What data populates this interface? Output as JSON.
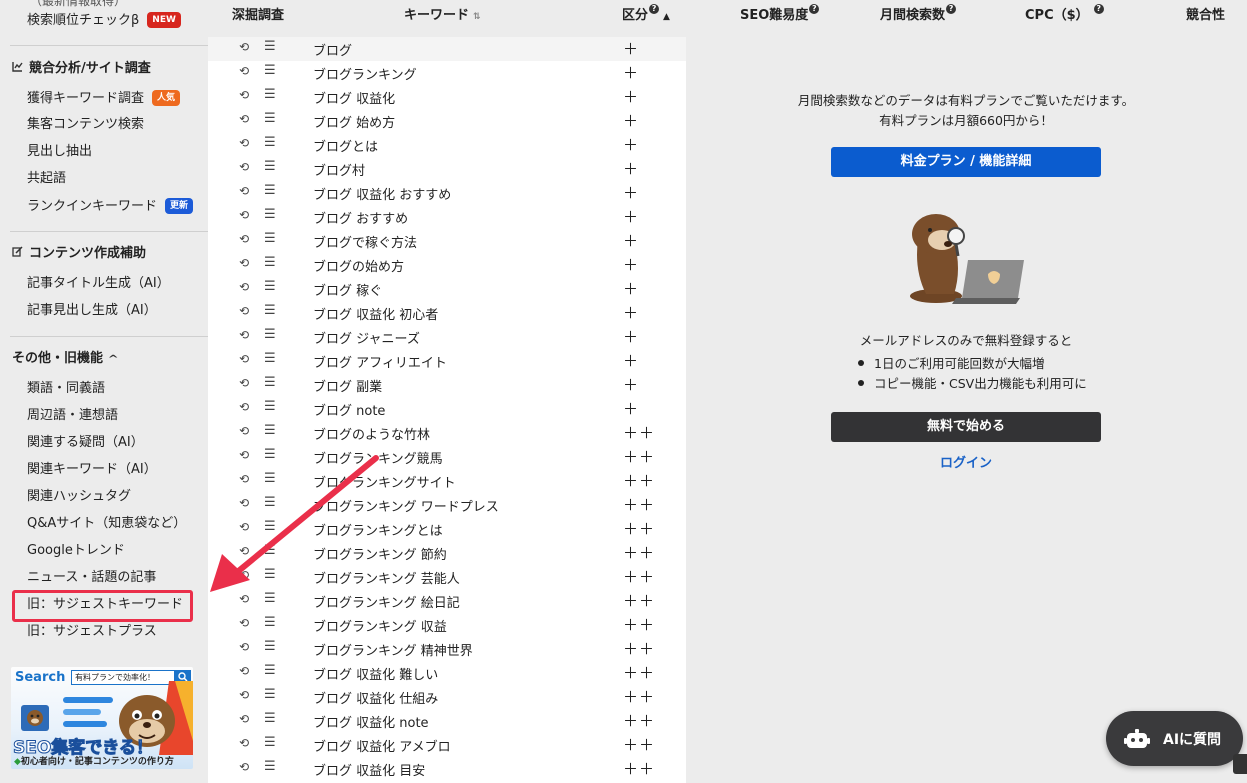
{
  "sidebar": {
    "top_cut": "（最新情報取得）",
    "items_top": [
      {
        "label": "検索順位チェックβ",
        "badge": "NEW"
      }
    ],
    "section_competitor": {
      "title": "競合分析/サイト調査",
      "items": [
        {
          "label": "獲得キーワード調査",
          "badge": "人気"
        },
        {
          "label": "集客コンテンツ検索",
          "badge": ""
        },
        {
          "label": "見出し抽出",
          "badge": ""
        },
        {
          "label": "共起語",
          "badge": ""
        },
        {
          "label": "ランクインキーワード",
          "badge": "更新"
        }
      ]
    },
    "section_content": {
      "title": "コンテンツ作成補助",
      "items": [
        {
          "label": "記事タイトル生成（AI）"
        },
        {
          "label": "記事見出し生成（AI）"
        }
      ]
    },
    "section_other": {
      "title": "その他・旧機能",
      "items": [
        {
          "label": "類語・同義語"
        },
        {
          "label": "周辺語・連想語"
        },
        {
          "label": "関連する疑問（AI）"
        },
        {
          "label": "関連キーワード（AI）"
        },
        {
          "label": "関連ハッシュタグ"
        },
        {
          "label": "Q&Aサイト（知恵袋など）"
        },
        {
          "label": "Googleトレンド"
        },
        {
          "label": "ニュース・話題の記事"
        },
        {
          "label": "旧：サジェストキーワード"
        },
        {
          "label": "旧：サジェストプラス"
        }
      ]
    },
    "banner": {
      "search_word": "Search",
      "box_text": "有料プランで効率化！",
      "title": "SEO集客できる！",
      "subtitle": "初心者向け・記事コンテンツの作り方"
    }
  },
  "header": {
    "col_dig": "深掘調査",
    "col_keyword": "キーワード",
    "col_category": "区分",
    "col_seo": "SEO難易度",
    "col_volume": "月間検索数",
    "col_cpc": "CPC（$）",
    "col_competition": "競合性"
  },
  "keywords": [
    {
      "kw": "ブログ",
      "cat": "＋"
    },
    {
      "kw": "ブログランキング",
      "cat": "＋"
    },
    {
      "kw": "ブログ 収益化",
      "cat": "＋"
    },
    {
      "kw": "ブログ 始め方",
      "cat": "＋"
    },
    {
      "kw": "ブログとは",
      "cat": "＋"
    },
    {
      "kw": "ブログ村",
      "cat": "＋"
    },
    {
      "kw": "ブログ 収益化 おすすめ",
      "cat": "＋"
    },
    {
      "kw": "ブログ おすすめ",
      "cat": "＋"
    },
    {
      "kw": "ブログで稼ぐ方法",
      "cat": "＋"
    },
    {
      "kw": "ブログの始め方",
      "cat": "＋"
    },
    {
      "kw": "ブログ 稼ぐ",
      "cat": "＋"
    },
    {
      "kw": "ブログ 収益化 初心者",
      "cat": "＋"
    },
    {
      "kw": "ブログ ジャニーズ",
      "cat": "＋"
    },
    {
      "kw": "ブログ アフィリエイト",
      "cat": "＋"
    },
    {
      "kw": "ブログ 副業",
      "cat": "＋"
    },
    {
      "kw": "ブログ note",
      "cat": "＋"
    },
    {
      "kw": "ブログのような竹林",
      "cat": "＋＋"
    },
    {
      "kw": "ブログランキング競馬",
      "cat": "＋＋"
    },
    {
      "kw": "ブログランキングサイト",
      "cat": "＋＋"
    },
    {
      "kw": "ブログランキング ワードプレス",
      "cat": "＋＋"
    },
    {
      "kw": "ブログランキングとは",
      "cat": "＋＋"
    },
    {
      "kw": "ブログランキング 節約",
      "cat": "＋＋"
    },
    {
      "kw": "ブログランキング 芸能人",
      "cat": "＋＋"
    },
    {
      "kw": "ブログランキング 絵日記",
      "cat": "＋＋"
    },
    {
      "kw": "ブログランキング 収益",
      "cat": "＋＋"
    },
    {
      "kw": "ブログランキング 精神世界",
      "cat": "＋＋"
    },
    {
      "kw": "ブログ 収益化 難しい",
      "cat": "＋＋"
    },
    {
      "kw": "ブログ 収益化 仕組み",
      "cat": "＋＋"
    },
    {
      "kw": "ブログ 収益化 note",
      "cat": "＋＋"
    },
    {
      "kw": "ブログ 収益化 アメブロ",
      "cat": "＋＋"
    },
    {
      "kw": "ブログ 収益化 目安",
      "cat": "＋＋"
    }
  ],
  "panel": {
    "msg_line1": "月間検索数などのデータは有料プランでご覧いただけます。",
    "msg_line2": "有料プランは月額660円から！",
    "plan_button": "料金プラン / 機能詳細",
    "register_msg": "メールアドレスのみで無料登録すると",
    "benefits": [
      "1日のご利用可能回数が大幅増",
      "コピー機能・CSV出力機能も利用可に"
    ],
    "start_button": "無料で始める",
    "login_link": "ログイン"
  },
  "ai_button": {
    "label": "AIに質問"
  },
  "colors": {
    "primary": "#0b5ccf",
    "dark_button": "#333335",
    "highlight": "#ea2f4a",
    "arrow": "#ea2f4a",
    "badge_new": "#d7261e",
    "badge_popular": "#ee6a1f",
    "badge_updated": "#1c5bd8"
  }
}
